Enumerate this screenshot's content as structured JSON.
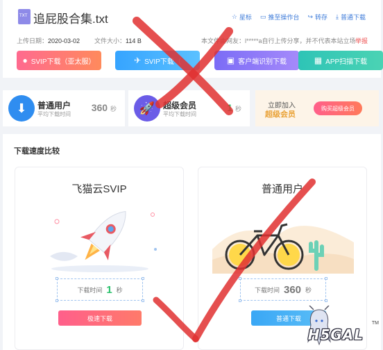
{
  "file": {
    "icon_label": "TXT",
    "name": "追屁股合集.txt",
    "actions": [
      {
        "icon": "star-icon",
        "glyph": "☆",
        "label": "星标"
      },
      {
        "icon": "tv-icon",
        "glyph": "▭",
        "label": "推至操作台"
      },
      {
        "icon": "forward-icon",
        "glyph": "↪",
        "label": "转存"
      },
      {
        "icon": "download-icon",
        "glyph": "⤓",
        "label": "普通下载"
      }
    ],
    "upload_date_label": "上传日期：",
    "upload_date": "2020-03-02",
    "size_label": "文件大小：",
    "size": "114 B",
    "notice": "本文件由网友：l*****a自行上传分享，并不代表本站立场",
    "report": "举报"
  },
  "download_buttons": [
    {
      "label": "SVIP下载（亚太服）",
      "icon": "planet-icon",
      "glyph": "🪐"
    },
    {
      "label": "SVIP下载（",
      "icon": "plane-icon",
      "glyph": "✈"
    },
    {
      "label": "客户端识别下载",
      "icon": "client-icon",
      "glyph": "▣"
    },
    {
      "label": "APP扫描下载",
      "icon": "qr-icon",
      "glyph": "▦"
    }
  ],
  "membership": {
    "normal": {
      "title": "普通用户",
      "subtitle": "平均下载时间",
      "value": "360",
      "unit": "秒"
    },
    "super": {
      "title": "超级会员",
      "subtitle": "平均下载时间",
      "value": "1",
      "unit": "秒"
    },
    "join": {
      "line1": "立即加入",
      "line2": "超级会员",
      "button": "购买超级会员"
    }
  },
  "compare": {
    "title": "下载速度比较",
    "left": {
      "name": "飞猫云SVIP",
      "time_label": "下载时间",
      "time": "1",
      "unit": "秒",
      "button": "极速下载"
    },
    "right": {
      "name": "普通用户",
      "time_label": "下载时间",
      "time": "360",
      "unit": "秒",
      "button": "普通下载"
    }
  },
  "watermark": {
    "text": "H5GAL",
    "tm": "TM"
  },
  "colors": {
    "accent_blue": "#3d7bd9",
    "overlay_red": "#e03030",
    "fast_green": "#27c06a",
    "gold": "#e9a135"
  }
}
